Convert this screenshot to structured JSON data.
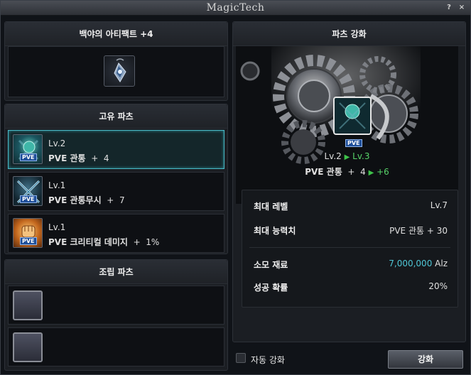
{
  "window": {
    "title": "MagicTech",
    "help_label": "?",
    "close_label": "×"
  },
  "artifact": {
    "title": "백야의 아티팩트 +4",
    "icon": "pendant-icon"
  },
  "unique_parts": {
    "title": "고유 파츠",
    "items": [
      {
        "level": "Lv.2",
        "stat_name": "PVE 관통",
        "stat_sep": "+",
        "stat_value": "4",
        "selected": true,
        "icon": "pve-orb-icon",
        "badge": "PVE"
      },
      {
        "level": "Lv.1",
        "stat_name": "PVE 관통무시",
        "stat_sep": "+",
        "stat_value": "7",
        "selected": false,
        "icon": "pve-cross-icon",
        "badge": "PVE"
      },
      {
        "level": "Lv.1",
        "stat_name": "PVE 크리티컬 데미지",
        "stat_sep": "+",
        "stat_value": "1%",
        "selected": false,
        "icon": "pve-fist-icon",
        "badge": "PVE"
      }
    ]
  },
  "assembly_parts": {
    "title": "조립 파츠",
    "slots": [
      "empty",
      "empty"
    ]
  },
  "enhance": {
    "title": "파츠 강화",
    "preview_badge": "PVE",
    "from_level": "Lv.2",
    "to_level": "Lv.3",
    "stat_name": "PVE 관통",
    "stat_sep": "+",
    "from_value": "4",
    "to_value": "+6",
    "info": {
      "max_level_label": "최대 레벨",
      "max_level_value": "Lv.7",
      "max_stat_label": "최대 능력치",
      "max_stat_value": "PVE 관통  + 30",
      "material_label": "소모 재료",
      "material_amount": "7,000,000",
      "material_unit": "Alz",
      "success_label": "성공 확률",
      "success_value": "20%"
    },
    "auto_label": "자동 강화",
    "auto_checked": false,
    "button_label": "강화"
  },
  "colors": {
    "accent_cyan": "#4fc6d6",
    "level_green": "#58d46a",
    "selected_border": "#49b9c6"
  }
}
